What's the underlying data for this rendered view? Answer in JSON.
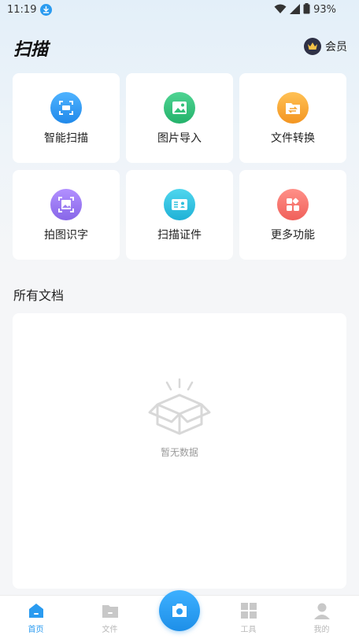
{
  "status_bar": {
    "time": "11:19",
    "battery": "93%"
  },
  "header": {
    "title": "扫描",
    "vip_label": "会员"
  },
  "tiles": [
    {
      "label": "智能扫描",
      "icon": "scan-icon",
      "color": "#2c98ef"
    },
    {
      "label": "图片导入",
      "icon": "image-import-icon",
      "color": "#34c27c"
    },
    {
      "label": "文件转换",
      "icon": "file-convert-icon",
      "color": "#f5a431"
    },
    {
      "label": "拍图识字",
      "icon": "photo-ocr-icon",
      "color": "#9a7cf0"
    },
    {
      "label": "扫描证件",
      "icon": "id-card-icon",
      "color": "#2fc0dd"
    },
    {
      "label": "更多功能",
      "icon": "more-features-icon",
      "color": "#f5706b"
    }
  ],
  "documents": {
    "section_title": "所有文档",
    "empty_text": "暂无数据"
  },
  "bottom_nav": {
    "items": [
      {
        "label": "首页",
        "icon": "home-icon",
        "active": true
      },
      {
        "label": "文件",
        "icon": "folder-icon",
        "active": false
      },
      {
        "label": "工具",
        "icon": "tools-grid-icon",
        "active": false
      },
      {
        "label": "我的",
        "icon": "user-icon",
        "active": false
      }
    ],
    "camera": {
      "icon": "camera-icon"
    }
  },
  "colors": {
    "accent": "#2a9bf0",
    "background": "#f5f6f8",
    "muted": "#b8b8b8"
  }
}
